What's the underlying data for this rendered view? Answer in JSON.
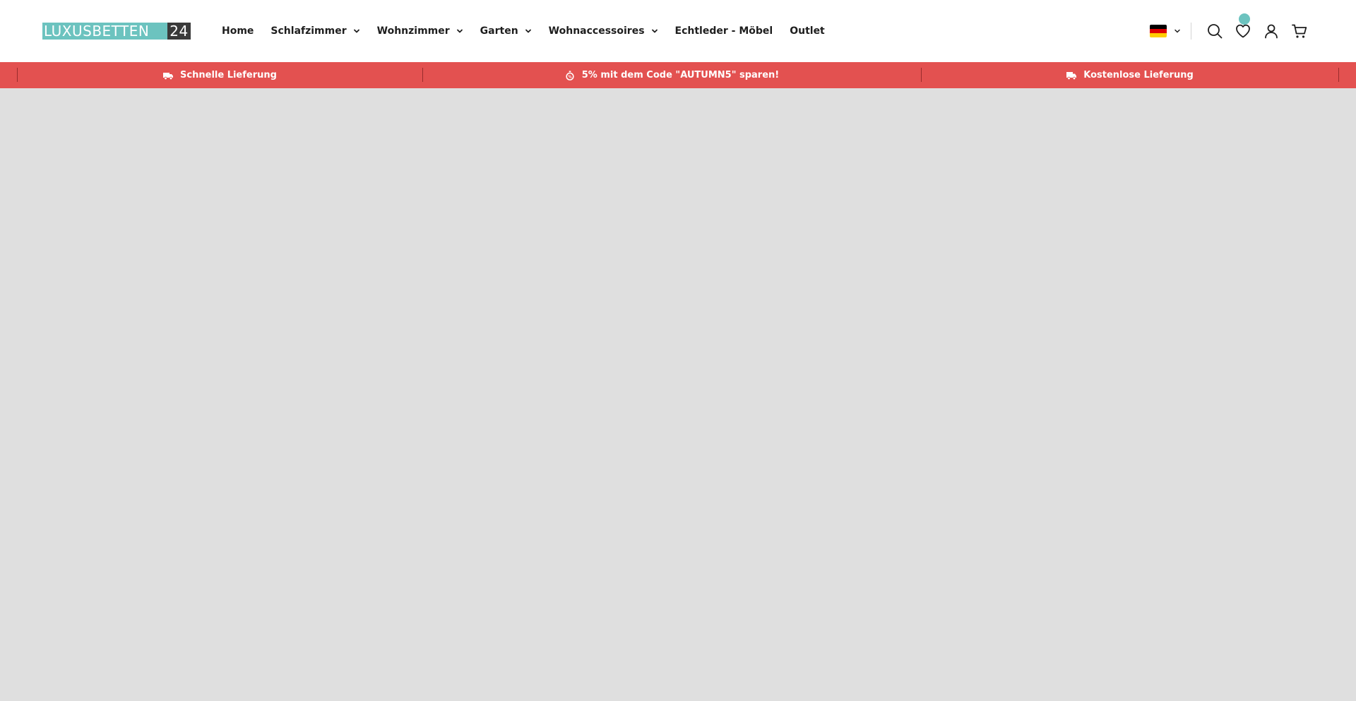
{
  "logo": {
    "main": "LUXUSBETTEN",
    "number": "24"
  },
  "nav": {
    "items": [
      {
        "label": "Home",
        "has_dropdown": false
      },
      {
        "label": "Schlafzimmer",
        "has_dropdown": true
      },
      {
        "label": "Wohnzimmer",
        "has_dropdown": true
      },
      {
        "label": "Garten",
        "has_dropdown": true
      },
      {
        "label": "Wohnaccessoires",
        "has_dropdown": true
      },
      {
        "label": "Echtleder - Möbel",
        "has_dropdown": false
      },
      {
        "label": "Outlet",
        "has_dropdown": false
      }
    ]
  },
  "header_actions": {
    "language_flag": "germany-flag-icon",
    "icons": [
      "search-icon",
      "heart-icon",
      "user-icon",
      "cart-icon"
    ]
  },
  "promo_bar": {
    "items": [
      {
        "icon": "truck-icon",
        "text": "Schnelle Lieferung"
      },
      {
        "icon": "stopwatch-icon",
        "text": "5% mit dem Code \"AUTUMN5\" sparen!"
      },
      {
        "icon": "delivery-truck-icon",
        "text": "Kostenlose Lieferung"
      }
    ]
  },
  "colors": {
    "brand_teal": "#6cc3bf",
    "logo_dark": "#3a3a3a",
    "promo_red": "#e35150",
    "page_background": "#dfdfdf",
    "text_dark": "#1e1e1e"
  }
}
